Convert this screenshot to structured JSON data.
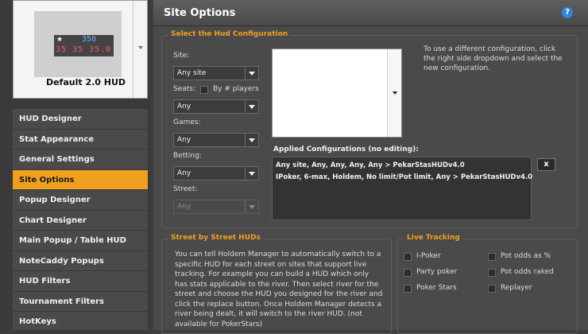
{
  "sidebar": {
    "hud_name": "Default 2.0 HUD",
    "preview": {
      "star": "★",
      "value_top": "350",
      "value_bottom": "35 35 35.0"
    },
    "items": [
      {
        "label": "HUD Designer",
        "active": false
      },
      {
        "label": "Stat Appearance",
        "active": false
      },
      {
        "label": "General Settings",
        "active": false
      },
      {
        "label": "Site Options",
        "active": true
      },
      {
        "label": "Popup Designer",
        "active": false
      },
      {
        "label": "Chart Designer",
        "active": false
      },
      {
        "label": "Main Popup / Table HUD",
        "active": false
      },
      {
        "label": "NoteCaddy Popups",
        "active": false
      },
      {
        "label": "HUD Filters",
        "active": false
      },
      {
        "label": "Tournament Filters",
        "active": false
      },
      {
        "label": "HotKeys",
        "active": false
      }
    ]
  },
  "header": {
    "title": "Site Options",
    "help": "?"
  },
  "hud_config": {
    "title": "Select the Hud Configuration",
    "site_label": "Site:",
    "site_value": "Any site",
    "seats_label": "Seats:",
    "by_players_label": "By # players",
    "seats_value": "Any",
    "games_label": "Games:",
    "games_value": "Any",
    "betting_label": "Betting:",
    "betting_value": "Any",
    "street_label": "Street:",
    "street_value": "Any",
    "hint": "To use a different configuration, click the right side dropdown and select the new configuration.",
    "applied_label": "Applied Configurations (no editing):",
    "applied": [
      "Any site, Any, Any, Any, Any > PekarStasHUDv4.0",
      "IPoker, 6-max, Holdem, No limit/Pot limit, Any > PekarStasHUDv4.0"
    ],
    "remove_label": "x"
  },
  "street_huds": {
    "title": "Street by Street HUDs",
    "text": "You can tell Holdem Manager to automatically switch to a specific HUD for each street on sites that support live tracking. For example you can build a HUD which only has stats applicable to the river. Then select river for the street and choose the HUD you designed for the river and click the replace button. Once Holdem Manager detects a river being dealt, it will switch to the river HUD. (not available for PokerStars)"
  },
  "live_tracking": {
    "title": "Live Tracking",
    "options": [
      {
        "label": "I-Poker",
        "checked": false
      },
      {
        "label": "Pot odds as %",
        "checked": false
      },
      {
        "label": "Party poker",
        "checked": false
      },
      {
        "label": "Pot odds raked",
        "checked": false
      },
      {
        "label": "Poker Stars",
        "checked": false
      },
      {
        "label": "Replayer",
        "checked": false
      }
    ]
  },
  "colors": {
    "accent": "#f0a020",
    "help": "#2f86e0"
  }
}
